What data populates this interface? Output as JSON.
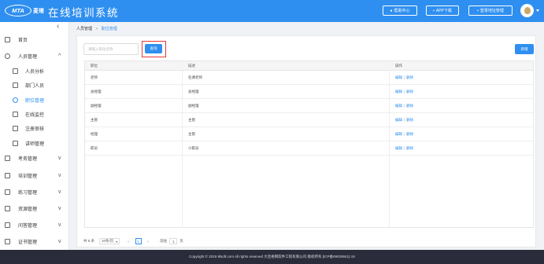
{
  "header": {
    "logo_text": "MTA",
    "logo_cn": "麦塔",
    "title": "在线培训系统",
    "buttons": [
      {
        "label": "帮助中心",
        "icon": "help-icon"
      },
      {
        "label": "APP下载",
        "icon": "download-icon"
      },
      {
        "label": "登录地址管理",
        "icon": "location-icon"
      }
    ],
    "colors": {
      "primary": "#2f8ff0",
      "footer": "#2b2c3b",
      "highlight": "#e53935"
    }
  },
  "sidebar": {
    "items": [
      {
        "label": "首页",
        "icon": "home-icon",
        "level": 1,
        "chevron": ""
      },
      {
        "label": "人员管理",
        "icon": "user-icon",
        "level": 1,
        "chevron": "^"
      },
      {
        "label": "人员分析",
        "icon": "org-icon",
        "level": 2,
        "chevron": ""
      },
      {
        "label": "部门人员",
        "icon": "people-icon",
        "level": 2,
        "chevron": ""
      },
      {
        "label": "职位管理",
        "icon": "position-icon",
        "level": 2,
        "chevron": "",
        "active": true
      },
      {
        "label": "在线监控",
        "icon": "monitor-icon",
        "level": 2,
        "chevron": ""
      },
      {
        "label": "注册审核",
        "icon": "audit-icon",
        "level": 2,
        "chevron": ""
      },
      {
        "label": "讲师管理",
        "icon": "lecturer-icon",
        "level": 2,
        "chevron": ""
      },
      {
        "label": "考务管理",
        "icon": "exam-icon",
        "level": 1,
        "chevron": "v"
      },
      {
        "label": "培训管理",
        "icon": "training-icon",
        "level": 1,
        "chevron": "v"
      },
      {
        "label": "练习管理",
        "icon": "practice-icon",
        "level": 1,
        "chevron": "v"
      },
      {
        "label": "资源管理",
        "icon": "resource-icon",
        "level": 1,
        "chevron": "v"
      },
      {
        "label": "问答管理",
        "icon": "qa-icon",
        "level": 1,
        "chevron": "v"
      },
      {
        "label": "证书管理",
        "icon": "certificate-icon",
        "level": 1,
        "chevron": "v"
      }
    ]
  },
  "breadcrumb": {
    "parent": "人员管理",
    "separator": ">",
    "current": "职位管理"
  },
  "toolbar": {
    "search_placeholder": "请输入职位名称",
    "query_label": "查询",
    "add_label": "新增"
  },
  "table": {
    "columns": [
      "职位",
      "描述",
      "操作"
    ],
    "rows": [
      {
        "position": "老师",
        "description": "任课老师"
      },
      {
        "position": "总经理",
        "description": "总经理"
      },
      {
        "position": "副经理",
        "description": "副经理"
      },
      {
        "position": "主管",
        "description": "主管"
      },
      {
        "position": "经理",
        "description": "主管"
      },
      {
        "position": "职员",
        "description": "小职员"
      }
    ],
    "edit_label": "编辑",
    "delete_label": "删除",
    "op_sep": "|"
  },
  "pager": {
    "total": "共 6 条",
    "page_size": "10条/页",
    "prev": "<",
    "current_page": "1",
    "next": ">",
    "goto_label": "前往",
    "goto_value": "1",
    "unit": "页"
  },
  "footer": {
    "text": "Copyright © 2019 8lsoft.com All rights reserved 大连格网软件工程有限公司 版权所有 [ICP备09029841]-19"
  }
}
